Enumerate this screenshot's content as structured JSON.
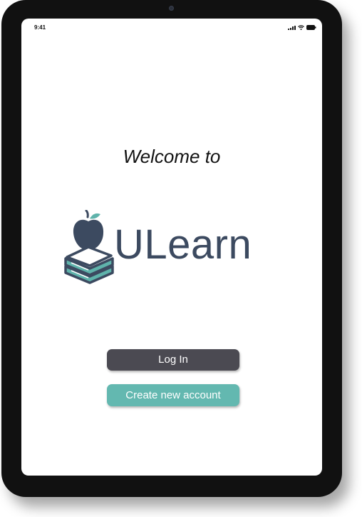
{
  "status_bar": {
    "time": "9:41",
    "icons": [
      "signal-icon",
      "wifi-icon",
      "battery-icon"
    ]
  },
  "welcome": {
    "text": "Welcome to"
  },
  "logo": {
    "brand": "ULearn",
    "icon": "apple-on-books-icon",
    "colors": {
      "dark": "#3c4a60",
      "teal": "#5fb3ab",
      "leaf": "#5fb3ab"
    }
  },
  "actions": {
    "login_label": "Log In",
    "create_account_label": "Create new account"
  },
  "colors": {
    "login_button": "#4b4a52",
    "create_button": "#63b8b0",
    "device_bezel": "#111111"
  }
}
